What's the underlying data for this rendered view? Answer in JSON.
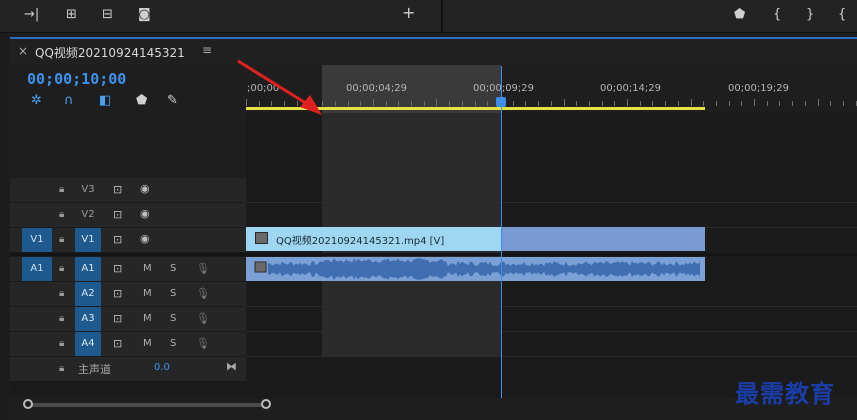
{
  "toolbar": {
    "left_icons": [
      "ripple-icon",
      "lift-icon",
      "extract-icon",
      "camera-icon"
    ],
    "add_label": "+",
    "right_icons": [
      "marker-icon",
      "in-bracket-icon",
      "out-bracket-icon",
      "goto-icon"
    ],
    "in_bracket": "{",
    "out_bracket": "}",
    "goto": "{",
    "right_last": "→"
  },
  "sequence_tab": {
    "close": "×",
    "title": "QQ视频20210924145321",
    "menu": "≡"
  },
  "timecode": "00;00;10;00",
  "tools": [
    "snap-icon",
    "magnet-icon",
    "linked-selection-icon",
    "add-marker-icon",
    "wrench-icon"
  ],
  "ruler": {
    "labels": [
      ";00;00",
      "00;00;04;29",
      "00;00;09;29",
      "00;00;14;29",
      "00;00;19;29"
    ]
  },
  "video_tracks": [
    {
      "name": "V3",
      "source": ""
    },
    {
      "name": "V2",
      "source": ""
    },
    {
      "name": "V1",
      "source": "V1"
    }
  ],
  "audio_tracks": [
    {
      "name": "A1",
      "source": "A1"
    },
    {
      "name": "A2",
      "source": ""
    },
    {
      "name": "A3",
      "source": ""
    },
    {
      "name": "A4",
      "source": ""
    }
  ],
  "mute_label": "M",
  "solo_label": "S",
  "master": {
    "label": "主声道",
    "value": "0.0"
  },
  "video_clip": {
    "label": "QQ视频20210924145321.mp4 [V]"
  },
  "watermark": "最需教育"
}
